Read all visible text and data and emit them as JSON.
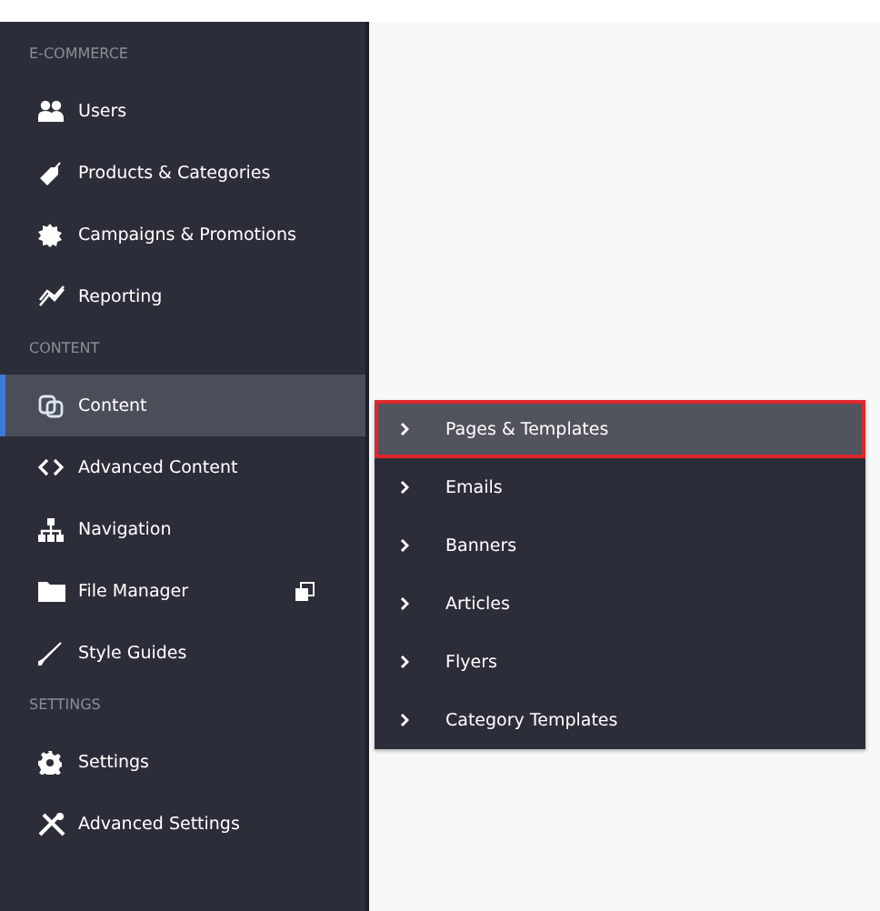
{
  "sidebar": {
    "sections": [
      {
        "heading": "E-COMMERCE",
        "items": [
          {
            "label": "Users",
            "selected": false
          },
          {
            "label": "Products & Categories",
            "selected": false
          },
          {
            "label": "Campaigns & Promotions",
            "selected": false
          },
          {
            "label": "Reporting",
            "selected": false
          }
        ]
      },
      {
        "heading": "CONTENT",
        "items": [
          {
            "label": "Content",
            "selected": true
          },
          {
            "label": "Advanced Content",
            "selected": false
          },
          {
            "label": "Navigation",
            "selected": false
          },
          {
            "label": "File Manager",
            "selected": false,
            "external": true
          },
          {
            "label": "Style Guides",
            "selected": false
          }
        ]
      },
      {
        "heading": "SETTINGS",
        "items": [
          {
            "label": "Settings",
            "selected": false
          },
          {
            "label": "Advanced Settings",
            "selected": false
          }
        ]
      }
    ]
  },
  "submenu": {
    "items": [
      {
        "label": "Pages & Templates",
        "selected": true
      },
      {
        "label": "Emails",
        "selected": false
      },
      {
        "label": "Banners",
        "selected": false
      },
      {
        "label": "Articles",
        "selected": false
      },
      {
        "label": "Flyers",
        "selected": false
      },
      {
        "label": "Category Templates",
        "selected": false
      }
    ]
  }
}
